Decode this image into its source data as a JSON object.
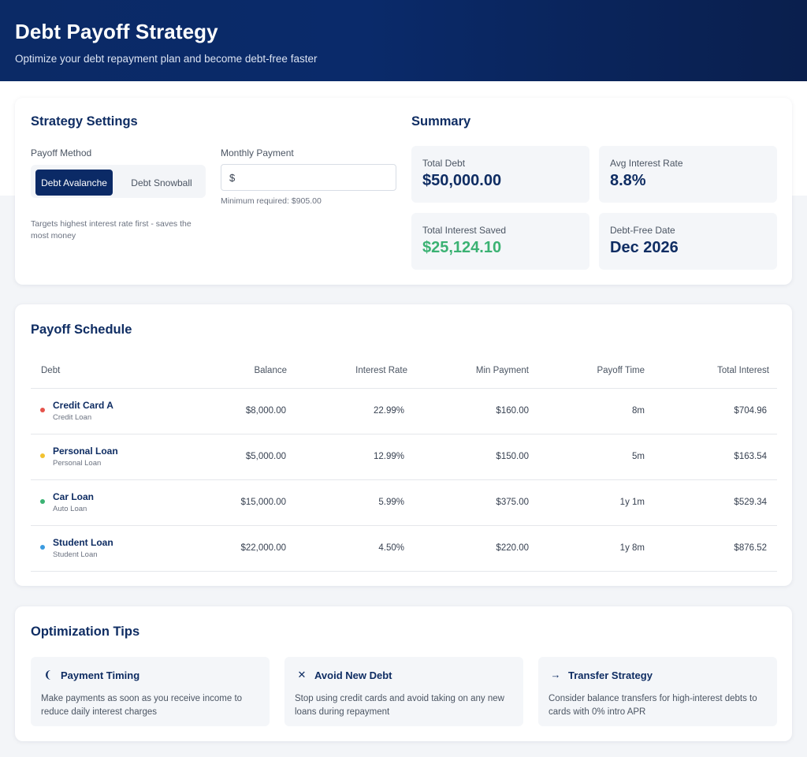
{
  "header": {
    "title": "Debt Payoff Strategy",
    "subtitle": "Optimize your debt repayment plan and become debt-free faster"
  },
  "settings": {
    "title": "Strategy Settings",
    "payoff_method_label": "Payoff Method",
    "methods": [
      "Debt Avalanche",
      "Debt Snowball"
    ],
    "selected_method": "Debt Avalanche",
    "method_hint": "Targets highest interest rate first - saves the most money",
    "monthly_payment_label": "Monthly Payment",
    "currency_symbol": "$",
    "monthly_payment_value": "",
    "min_required": "Minimum required: $905.00"
  },
  "summary": {
    "title": "Summary",
    "total_debt_label": "Total Debt",
    "total_debt": "$50,000.00",
    "avg_rate_label": "Avg Interest Rate",
    "avg_rate": "8.8%",
    "interest_saved_label": "Total Interest Saved",
    "interest_saved": "$25,124.10",
    "debt_free_label": "Debt-Free Date",
    "debt_free_date": "Dec 2026"
  },
  "schedule": {
    "title": "Payoff Schedule",
    "columns": [
      "Debt",
      "Balance",
      "Interest Rate",
      "Min Payment",
      "Payoff Time",
      "Total Interest"
    ],
    "rows": [
      {
        "name": "Credit Card A",
        "type": "Credit Loan",
        "balance": "$8,000.00",
        "rate": "22.99%",
        "min_payment": "$160.00",
        "payoff_time": "8m",
        "total_interest": "$704.96",
        "color": "#e5534b"
      },
      {
        "name": "Personal Loan",
        "type": "Personal Loan",
        "balance": "$5,000.00",
        "rate": "12.99%",
        "min_payment": "$150.00",
        "payoff_time": "5m",
        "total_interest": "$163.54",
        "color": "#f2c230"
      },
      {
        "name": "Car Loan",
        "type": "Auto Loan",
        "balance": "$15,000.00",
        "rate": "5.99%",
        "min_payment": "$375.00",
        "payoff_time": "1y 1m",
        "total_interest": "$529.34",
        "color": "#3bb273"
      },
      {
        "name": "Student Loan",
        "type": "Student Loan",
        "balance": "$22,000.00",
        "rate": "4.50%",
        "min_payment": "$220.00",
        "payoff_time": "1y 8m",
        "total_interest": "$876.52",
        "color": "#3b9be0"
      }
    ]
  },
  "tips": {
    "title": "Optimization Tips",
    "items": [
      {
        "icon": "clock-icon",
        "glyph": "❨",
        "title": "Payment Timing",
        "body": "Make payments as soon as you receive income to reduce daily interest charges"
      },
      {
        "icon": "close-icon",
        "glyph": "✕",
        "title": "Avoid New Debt",
        "body": "Stop using credit cards and avoid taking on any new loans during repayment"
      },
      {
        "icon": "arrow-right-icon",
        "glyph": "→",
        "title": "Transfer Strategy",
        "body": "Consider balance transfers for high-interest debts to cards with 0% intro APR"
      }
    ]
  }
}
